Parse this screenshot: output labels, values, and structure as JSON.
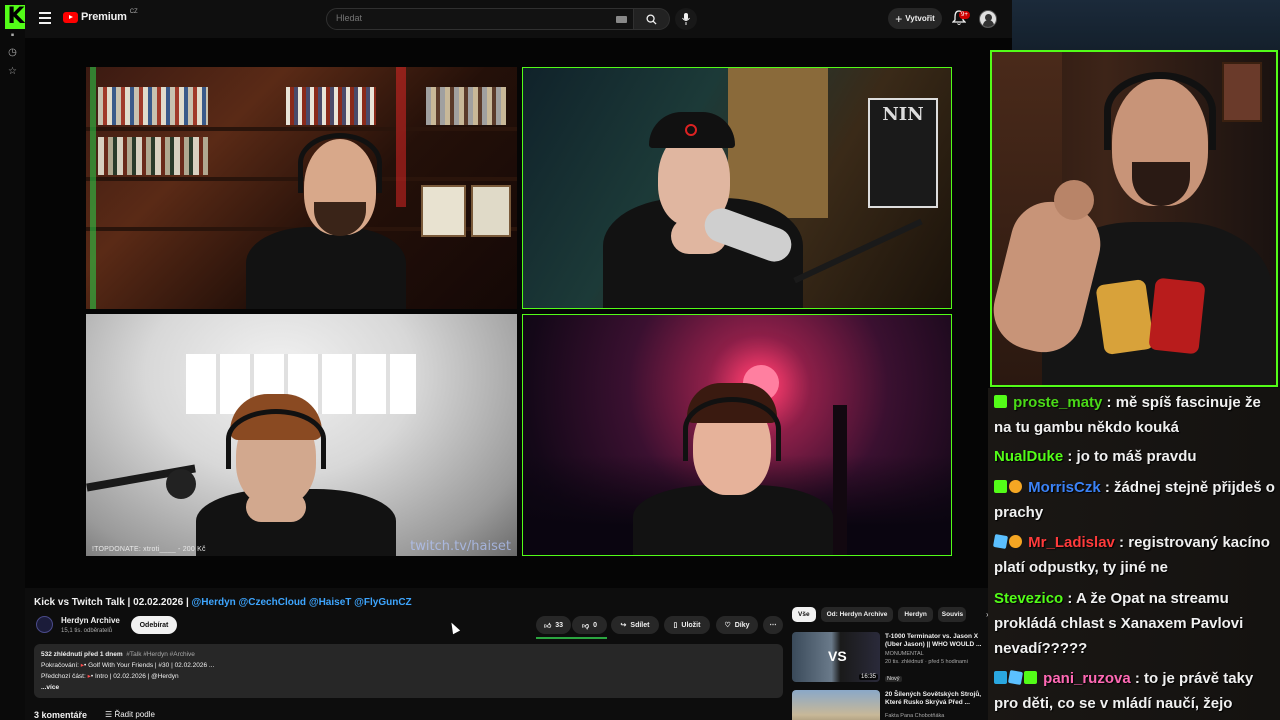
{
  "app": {
    "logo_letter": "K",
    "brand_color": "#53fc18"
  },
  "youtube": {
    "logo_text": "Premium",
    "logo_country": "CZ",
    "search_placeholder": "Hledat",
    "create_label": "Vytvořit",
    "notification_count": "9+"
  },
  "video": {
    "title_plain": "Kick vs Twitch Talk | 02.02.2026 | ",
    "title_mentions": "@Herdyn @CzechCloud @HaiseT @FlyGunCZ",
    "channel_name": "Herdyn Archive",
    "channel_subs": "15,1 tis. odběratelů",
    "subscribe_label": "Odebírat",
    "likes": "33",
    "dislikes": "0",
    "share_label": "Sdílet",
    "save_label": "Uložit",
    "thanks_label": "Díky",
    "cam_overlay_left": "!TOPDONATE: xtroti____ - 200 Kč",
    "cam_watermark": "twitch.tv/haiset",
    "description": {
      "stats": "532 zhlédnutí  před 1 dnem",
      "tags": "#Talk #Herdyn #Archive",
      "continuation_label": "Pokračování:",
      "continuation_value": "• Golf With Your Friends | #30 | 02.02.2026 ...",
      "previous_label": "Předchozí část:",
      "previous_value": "• Intro | 02.02.2026 | @Herdyn",
      "more_label": "...více"
    },
    "comments_count": "3 komentáře",
    "sort_label": "Řadit podle"
  },
  "sidebar_chips": [
    "Vše",
    "Od: Herdyn Archive",
    "Herdyn",
    "Souvis"
  ],
  "recommendations": [
    {
      "title": "T-1000 Terminator vs. Jason X (Uber Jason) || WHO WOULD ...",
      "channel": "MONUMENTAL",
      "meta": "20 tis. zhlédnutí · před 5 hodinami",
      "badge": "Nový",
      "duration": "16:35",
      "thumb_text": "VS"
    },
    {
      "title": "20 Šílených Sovětských Strojů, Které Rusko Skrývá Před ...",
      "channel": "Fakta Pana Chobotňáka",
      "meta": "",
      "badge": "",
      "duration": "",
      "thumb_text": ""
    }
  ],
  "chat": [
    {
      "user": "proste_maty",
      "color": "#53fc18",
      "text": "mě spíš fascinuje že na tu gambu někdo kouká",
      "badges": [
        "green"
      ]
    },
    {
      "user": "NualDuke",
      "color": "#53fc18",
      "text": "jo to máš pravdu",
      "badges": []
    },
    {
      "user": "MorrisCzk",
      "color": "#3b82f6",
      "text": "žádnej stejně přijdeš o prachy",
      "badges": [
        "green",
        "gold"
      ]
    },
    {
      "user": "Mr_Ladislav",
      "color": "#ff3b3b",
      "text": "registrovaný kacíno platí odpustky, ty jiné ne",
      "badges": [
        "cube",
        "gold"
      ]
    },
    {
      "user": "Stevezico",
      "color": "#53fc18",
      "text": "A že Opat na streamu prokládá chlast s Xanaxem Pavlovi nevadí?????",
      "badges": []
    },
    {
      "user": "pani_ruzova",
      "color": "#ff69b4",
      "text": "to je právě taky pro děti, co se v mládí naučí, žejo",
      "badges": [
        "blue",
        "cube",
        "green"
      ]
    }
  ]
}
